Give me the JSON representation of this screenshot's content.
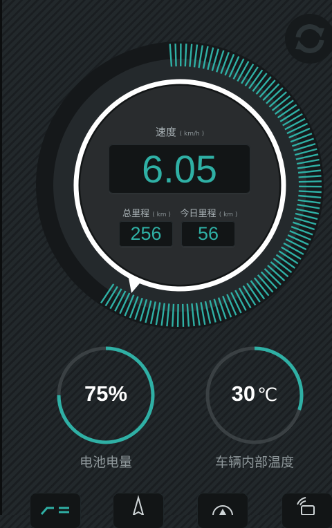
{
  "speed": {
    "title": "速度",
    "unit": "( km/h )",
    "value": "6.05",
    "level": 0.62
  },
  "odometer": {
    "total": {
      "title": "总里程",
      "unit": "( km )",
      "value": "256"
    },
    "today": {
      "title": "今日里程",
      "unit": "( km )",
      "value": "56"
    }
  },
  "battery": {
    "value": "75%",
    "label": "电池电量",
    "level": 0.75
  },
  "temperature": {
    "value": "30",
    "unit": "℃",
    "label": "车辆内部温度",
    "level": 0.3
  },
  "icons": {
    "refresh": "refresh-icon",
    "bottom": [
      "vehicle-lights-icon",
      "navigation-icon",
      "compass-icon",
      "phone-signal-icon"
    ]
  },
  "colors": {
    "accent": "#2fb0a5",
    "ring": "#ffffff",
    "track": "#3a4043",
    "background": "#1f2427"
  }
}
